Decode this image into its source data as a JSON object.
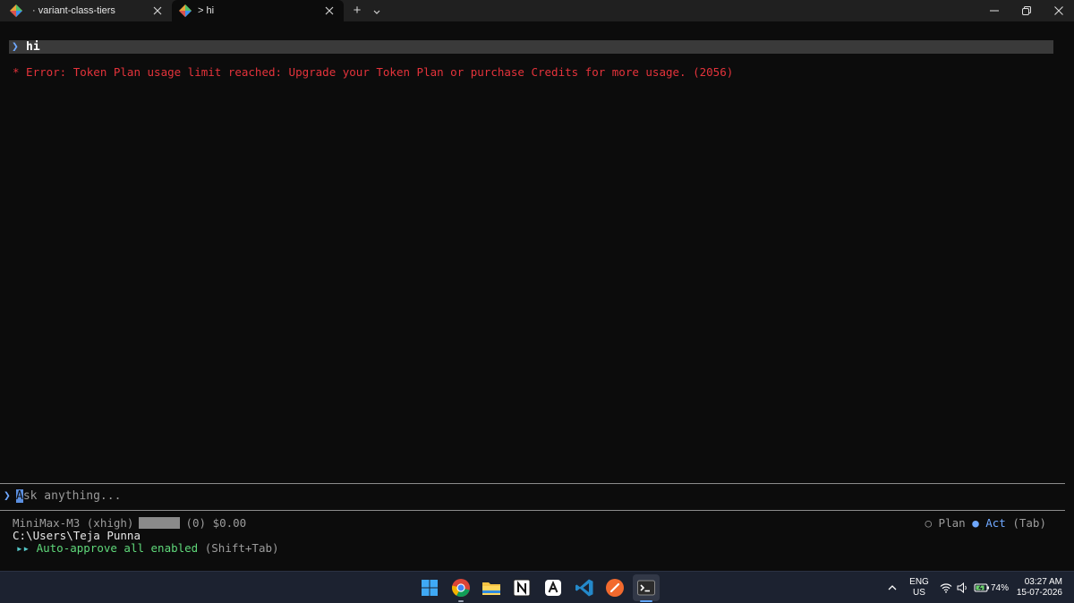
{
  "tabs": [
    {
      "label": "· variant-class-tiers",
      "active": false
    },
    {
      "label": "> hi",
      "active": true
    }
  ],
  "new_tab_label": "+",
  "terminal": {
    "prompt_symbol": "❯",
    "user_message": "hi",
    "error_text": "* Error: Token Plan usage limit reached: Upgrade your Token Plan or purchase Credits for more usage. (2056)",
    "input": {
      "cursor_char": "A",
      "placeholder_rest": "sk anything..."
    },
    "status": {
      "model": "MiniMax-M3 (xhigh)",
      "tokens": "(0)",
      "cost": "$0.00"
    },
    "mode": {
      "plan_label": "Plan",
      "act_label": "Act",
      "hint": "(Tab)",
      "selected": "Act"
    },
    "cwd": "C:\\Users\\Teja Punna",
    "auto_approve": {
      "arrows": "▸▸",
      "text": "Auto-approve all enabled",
      "hint": "(Shift+Tab)"
    }
  },
  "taskbar": {
    "language": "ENG",
    "region": "US",
    "battery": "74%",
    "time": "03:27 AM",
    "date": "15-07-2026",
    "pinned_apps": [
      "windows-start",
      "chrome",
      "file-explorer",
      "notion",
      "app-a",
      "vscode",
      "app-orange",
      "terminal"
    ]
  },
  "colors": {
    "accent": "#6fa8ff",
    "error": "#e5333b",
    "success": "#5fd87a",
    "background": "#0c0c0c"
  }
}
